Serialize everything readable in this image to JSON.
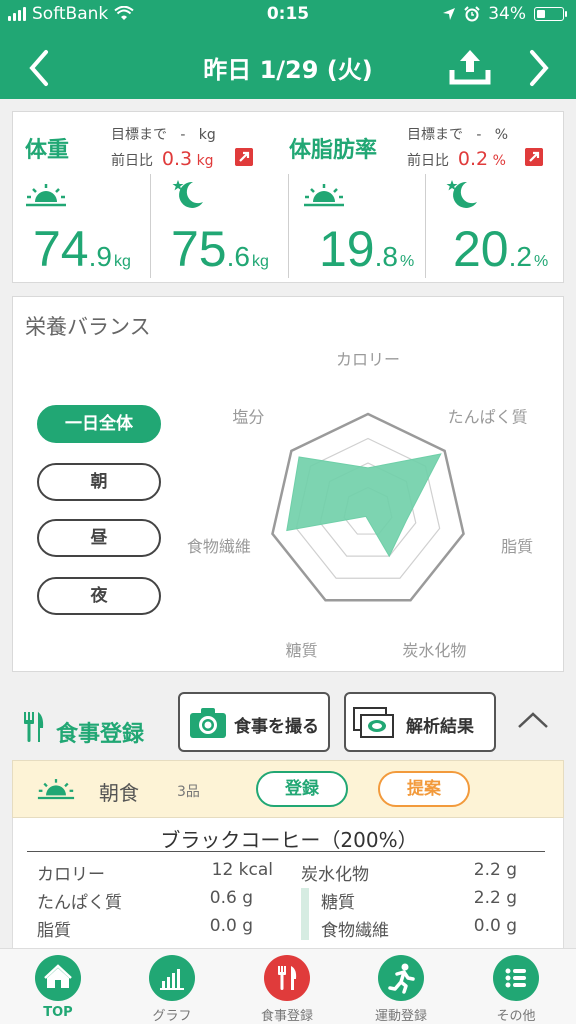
{
  "status": {
    "carrier": "SoftBank",
    "time": "0:15",
    "battery": "34%"
  },
  "header": {
    "title": "昨日 1/29 (火)"
  },
  "weight": {
    "title": "体重",
    "target_label": "目標まで",
    "target_value": "-",
    "target_unit": "kg",
    "diff_label": "前日比",
    "diff_value": "0.3",
    "diff_unit": "kg",
    "morning_int": "74",
    "morning_dec": ".9",
    "morning_unit": "kg",
    "night_int": "75",
    "night_dec": ".6",
    "night_unit": "kg"
  },
  "bodyfat": {
    "title": "体脂肪率",
    "target_label": "目標まで",
    "target_value": "-",
    "target_unit": "%",
    "diff_label": "前日比",
    "diff_value": "0.2",
    "diff_unit": "%",
    "morning_int": "19",
    "morning_dec": ".8",
    "morning_unit": "%",
    "night_int": "20",
    "night_dec": ".2",
    "night_unit": "%"
  },
  "nutrition": {
    "title": "栄養バランス",
    "periods": [
      "一日全体",
      "朝",
      "昼",
      "夜"
    ],
    "active_period": "一日全体"
  },
  "chart_data": {
    "type": "radar",
    "categories": [
      "カロリー",
      "たんぱく質",
      "脂質",
      "炭水化物",
      "糖質",
      "食物繊維",
      "塩分"
    ],
    "values": [
      0.45,
      0.95,
      0.4,
      0.5,
      0.05,
      0.85,
      0.9
    ],
    "ylim": [
      0,
      1
    ],
    "fill_color": "#6fcfa8"
  },
  "meal": {
    "section_label": "食事登録",
    "photo_button": "食事を撮る",
    "analysis_button": "解析結果",
    "breakfast": {
      "label": "朝食",
      "count": "3品",
      "register": "登録",
      "suggest": "提案"
    },
    "food": {
      "name": "ブラックコーヒー（200%）",
      "rows_left": [
        {
          "label": "カロリー",
          "value": "12 kcal"
        },
        {
          "label": "たんぱく質",
          "value": "0.6 g"
        },
        {
          "label": "脂質",
          "value": "0.0 g"
        }
      ],
      "rows_right": [
        {
          "label": "炭水化物",
          "value": "2.2 g"
        },
        {
          "label": "糖質",
          "value": "2.2 g"
        },
        {
          "label": "食物繊維",
          "value": "0.0 g"
        }
      ]
    }
  },
  "tabs": [
    {
      "label": "TOP",
      "icon": "home-icon"
    },
    {
      "label": "グラフ",
      "icon": "graph-icon"
    },
    {
      "label": "食事登録",
      "icon": "fork-knife-icon"
    },
    {
      "label": "運動登録",
      "icon": "runner-icon"
    },
    {
      "label": "その他",
      "icon": "list-icon"
    }
  ],
  "colors": {
    "brand": "#21a774",
    "alert": "#e03b3b",
    "suggest": "#f29a3c"
  }
}
